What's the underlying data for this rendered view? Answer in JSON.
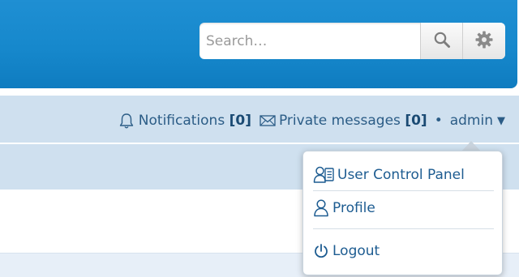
{
  "header": {
    "search": {
      "placeholder": "Search…",
      "search_icon": "magnifier-icon",
      "settings_icon": "gear-icon"
    }
  },
  "nav": {
    "notifications_label": "Notifications",
    "notifications_count": "[0]",
    "notifications_icon": "bell-icon",
    "messages_label": "Private messages",
    "messages_count": "[0]",
    "messages_icon": "envelope-icon",
    "separator": "•",
    "username": "admin",
    "caret": "▼"
  },
  "user_menu": {
    "items": [
      {
        "label": "User Control Panel",
        "icon": "user-card-icon"
      },
      {
        "label": "Profile",
        "icon": "user-icon"
      },
      {
        "label": "Logout",
        "icon": "power-icon"
      }
    ]
  },
  "colors": {
    "header_blue": "#1688cc",
    "nav_bg": "#cfe0ef",
    "link": "#2b5c86"
  }
}
